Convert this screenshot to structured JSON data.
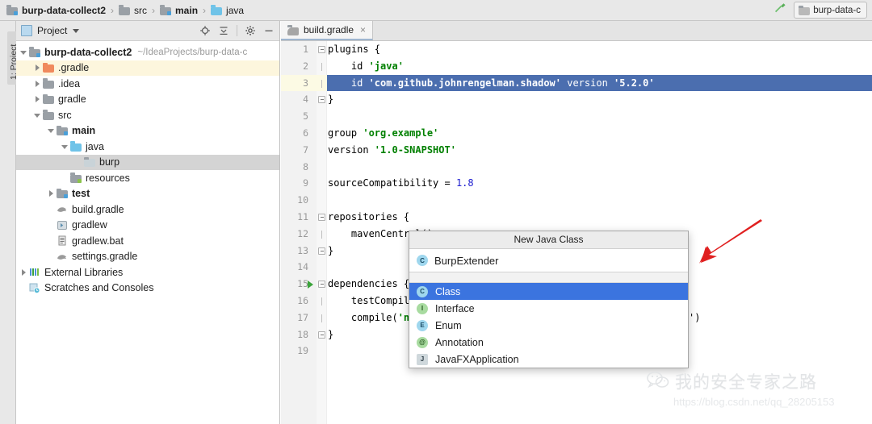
{
  "navbar": {
    "breadcrumbs": [
      {
        "label": "burp-data-collect2",
        "icon": "module-folder-icon",
        "bold": true
      },
      {
        "label": "src",
        "icon": "folder-icon",
        "bold": false
      },
      {
        "label": "main",
        "icon": "module-folder-icon",
        "bold": true
      },
      {
        "label": "java",
        "icon": "source-folder-icon",
        "bold": false
      }
    ],
    "separator": "›",
    "build_icon": "hammer-icon",
    "run_config": {
      "label": "burp-data-c",
      "icon": "gradle-icon"
    }
  },
  "left_strip": {
    "project_tab": "1: Project"
  },
  "project_panel": {
    "title": "Project",
    "actions": [
      {
        "name": "locate-icon"
      },
      {
        "name": "collapse-all-icon"
      },
      {
        "name": "settings-gear-icon"
      },
      {
        "name": "hide-panel-icon"
      }
    ],
    "tree": [
      {
        "label": "burp-data-collect2",
        "path": "~/IdeaProjects/burp-data-c",
        "indent": 0,
        "arrow": "open",
        "icon": "module-folder-icon",
        "bold": true,
        "state": "none"
      },
      {
        "label": ".gradle",
        "path": "",
        "indent": 1,
        "arrow": "closed",
        "icon": "gradle-folder-icon",
        "bold": false,
        "state": "highlight"
      },
      {
        "label": ".idea",
        "path": "",
        "indent": 1,
        "arrow": "closed",
        "icon": "folder-icon",
        "bold": false,
        "state": "none"
      },
      {
        "label": "gradle",
        "path": "",
        "indent": 1,
        "arrow": "closed",
        "icon": "folder-icon",
        "bold": false,
        "state": "none"
      },
      {
        "label": "src",
        "path": "",
        "indent": 1,
        "arrow": "open",
        "icon": "folder-icon",
        "bold": false,
        "state": "none"
      },
      {
        "label": "main",
        "path": "",
        "indent": 2,
        "arrow": "open",
        "icon": "module-folder-icon",
        "bold": true,
        "state": "none"
      },
      {
        "label": "java",
        "path": "",
        "indent": 3,
        "arrow": "open",
        "icon": "source-folder-icon",
        "bold": false,
        "state": "none"
      },
      {
        "label": "burp",
        "path": "",
        "indent": 4,
        "arrow": "none",
        "icon": "package-folder-icon",
        "bold": false,
        "state": "selected"
      },
      {
        "label": "resources",
        "path": "",
        "indent": 3,
        "arrow": "none",
        "icon": "resource-folder-icon",
        "bold": false,
        "state": "none"
      },
      {
        "label": "test",
        "path": "",
        "indent": 2,
        "arrow": "closed",
        "icon": "test-folder-icon",
        "bold": true,
        "state": "none"
      },
      {
        "label": "build.gradle",
        "path": "",
        "indent": 2,
        "arrow": "none",
        "icon": "gradle-file-icon",
        "bold": false,
        "state": "none"
      },
      {
        "label": "gradlew",
        "path": "",
        "indent": 2,
        "arrow": "none",
        "icon": "script-file-icon",
        "bold": false,
        "state": "none"
      },
      {
        "label": "gradlew.bat",
        "path": "",
        "indent": 2,
        "arrow": "none",
        "icon": "bat-file-icon",
        "bold": false,
        "state": "none"
      },
      {
        "label": "settings.gradle",
        "path": "",
        "indent": 2,
        "arrow": "none",
        "icon": "gradle-file-icon",
        "bold": false,
        "state": "none"
      },
      {
        "label": "External Libraries",
        "path": "",
        "indent": 0,
        "arrow": "closed",
        "icon": "libraries-icon",
        "bold": false,
        "state": "none"
      },
      {
        "label": "Scratches and Consoles",
        "path": "",
        "indent": 0,
        "arrow": "none",
        "icon": "scratches-icon",
        "bold": false,
        "state": "none"
      }
    ]
  },
  "editor": {
    "tab": {
      "label": "build.gradle",
      "icon": "gradle-file-icon",
      "close": "×"
    },
    "lines": [
      {
        "n": "1",
        "fold": "minus",
        "run": false,
        "cur": false,
        "sel": false,
        "segs": [
          {
            "t": "plugins {",
            "c": "plain"
          }
        ]
      },
      {
        "n": "2",
        "fold": "line",
        "run": false,
        "cur": false,
        "sel": false,
        "segs": [
          {
            "t": "    id ",
            "c": "plain"
          },
          {
            "t": "'java'",
            "c": "str"
          }
        ]
      },
      {
        "n": "3",
        "fold": "line",
        "run": false,
        "cur": true,
        "sel": true,
        "segs": [
          {
            "t": "    id ",
            "c": "plain"
          },
          {
            "t": "'com.github.johnrengelman.shadow'",
            "c": "str"
          },
          {
            "t": " version ",
            "c": "plain"
          },
          {
            "t": "'5.2.0'",
            "c": "str"
          }
        ]
      },
      {
        "n": "4",
        "fold": "plus",
        "run": false,
        "cur": false,
        "sel": false,
        "segs": [
          {
            "t": "}",
            "c": "plain"
          }
        ]
      },
      {
        "n": "5",
        "fold": "none",
        "run": false,
        "cur": false,
        "sel": false,
        "segs": []
      },
      {
        "n": "6",
        "fold": "none",
        "run": false,
        "cur": false,
        "sel": false,
        "segs": [
          {
            "t": "group ",
            "c": "plain"
          },
          {
            "t": "'org.example'",
            "c": "str"
          }
        ]
      },
      {
        "n": "7",
        "fold": "none",
        "run": false,
        "cur": false,
        "sel": false,
        "segs": [
          {
            "t": "version ",
            "c": "plain"
          },
          {
            "t": "'1.0-SNAPSHOT'",
            "c": "str"
          }
        ]
      },
      {
        "n": "8",
        "fold": "none",
        "run": false,
        "cur": false,
        "sel": false,
        "segs": []
      },
      {
        "n": "9",
        "fold": "none",
        "run": false,
        "cur": false,
        "sel": false,
        "segs": [
          {
            "t": "sourceCompatibility = ",
            "c": "plain"
          },
          {
            "t": "1.8",
            "c": "num"
          }
        ]
      },
      {
        "n": "10",
        "fold": "none",
        "run": false,
        "cur": false,
        "sel": false,
        "segs": []
      },
      {
        "n": "11",
        "fold": "minus",
        "run": false,
        "cur": false,
        "sel": false,
        "segs": [
          {
            "t": "repositories {",
            "c": "plain"
          }
        ]
      },
      {
        "n": "12",
        "fold": "line",
        "run": false,
        "cur": false,
        "sel": false,
        "segs": [
          {
            "t": "    mavenCentral()",
            "c": "plain"
          }
        ]
      },
      {
        "n": "13",
        "fold": "plus",
        "run": false,
        "cur": false,
        "sel": false,
        "segs": [
          {
            "t": "}",
            "c": "plain"
          }
        ]
      },
      {
        "n": "14",
        "fold": "none",
        "run": false,
        "cur": false,
        "sel": false,
        "segs": []
      },
      {
        "n": "15",
        "fold": "minus",
        "run": true,
        "cur": false,
        "sel": false,
        "segs": [
          {
            "t": "dependencies {",
            "c": "plain"
          }
        ]
      },
      {
        "n": "16",
        "fold": "line",
        "run": false,
        "cur": false,
        "sel": false,
        "segs": [
          {
            "t": "    testCompile",
            "c": "plain"
          }
        ]
      },
      {
        "n": "17",
        "fold": "line",
        "run": false,
        "cur": false,
        "sel": false,
        "segs": [
          {
            "t": "    compile(",
            "c": "plain"
          },
          {
            "t": "'net",
            "c": "str"
          }
        ]
      },
      {
        "n": "18",
        "fold": "plus",
        "run": false,
        "cur": false,
        "sel": false,
        "segs": [
          {
            "t": "}",
            "c": "plain"
          }
        ]
      },
      {
        "n": "19",
        "fold": "none",
        "run": false,
        "cur": false,
        "sel": false,
        "segs": []
      }
    ],
    "line17_tail": "')"
  },
  "new_java_class_dialog": {
    "title": "New Java Class",
    "input": {
      "value": "BurpExtender",
      "icon": "class-icon"
    },
    "items": [
      {
        "label": "Class",
        "icon": "class-icon",
        "kind": "c",
        "selected": true
      },
      {
        "label": "Interface",
        "icon": "interface-icon",
        "kind": "i",
        "selected": false
      },
      {
        "label": "Enum",
        "icon": "enum-icon",
        "kind": "e",
        "selected": false
      },
      {
        "label": "Annotation",
        "icon": "annotation-icon",
        "kind": "a",
        "selected": false
      },
      {
        "label": "JavaFXApplication",
        "icon": "javafx-icon",
        "kind": "fx",
        "selected": false
      }
    ],
    "selection_color": "#3b74df"
  },
  "annotation": {
    "arrow_color": "#e02020",
    "arrow_name": "red-pointer-arrow"
  },
  "watermark": {
    "icon": "wechat-icon",
    "text": "我的安全专家之路",
    "url": "https://blog.csdn.net/qq_28205153"
  }
}
